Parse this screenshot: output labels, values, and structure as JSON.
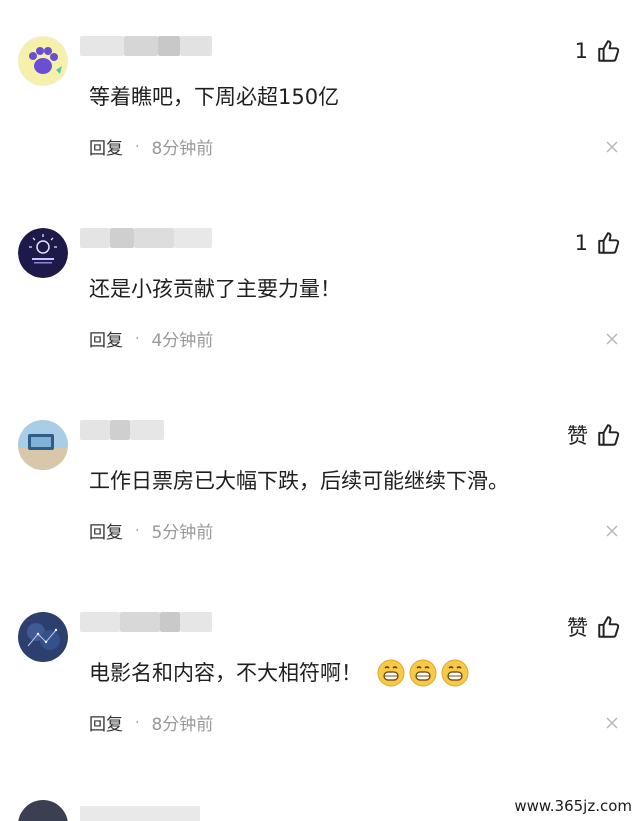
{
  "comments": [
    {
      "text": "等着瞧吧，下周必超150亿",
      "likes": "1",
      "reply": "回复",
      "separator": "·",
      "time": "8分钟前",
      "avatar": "purple-paw-avatar"
    },
    {
      "text": "还是小孩贡献了主要力量！",
      "likes": "1",
      "reply": "回复",
      "separator": "·",
      "time": "4分钟前",
      "avatar": "dark-navy-logo-avatar"
    },
    {
      "text": "工作日票房已大幅下跌，后续可能继续下滑。",
      "likes": "赞",
      "reply": "回复",
      "separator": "·",
      "time": "5分钟前",
      "avatar": "sky-photo-avatar"
    },
    {
      "text": "电影名和内容，不大相符啊！",
      "likes": "赞",
      "reply": "回复",
      "separator": "·",
      "time": "8分钟前",
      "avatar": "night-sky-avatar",
      "emojis": [
        "grinning-face-emoji",
        "grinning-face-emoji",
        "grinning-face-emoji"
      ]
    }
  ],
  "watermark": "www.365jz.com",
  "icons": {
    "like": "thumbs-up-icon",
    "close": "close-icon"
  },
  "colors": {
    "time": "#999999",
    "text": "#1f1f1f",
    "emoji": "#f7c948"
  }
}
